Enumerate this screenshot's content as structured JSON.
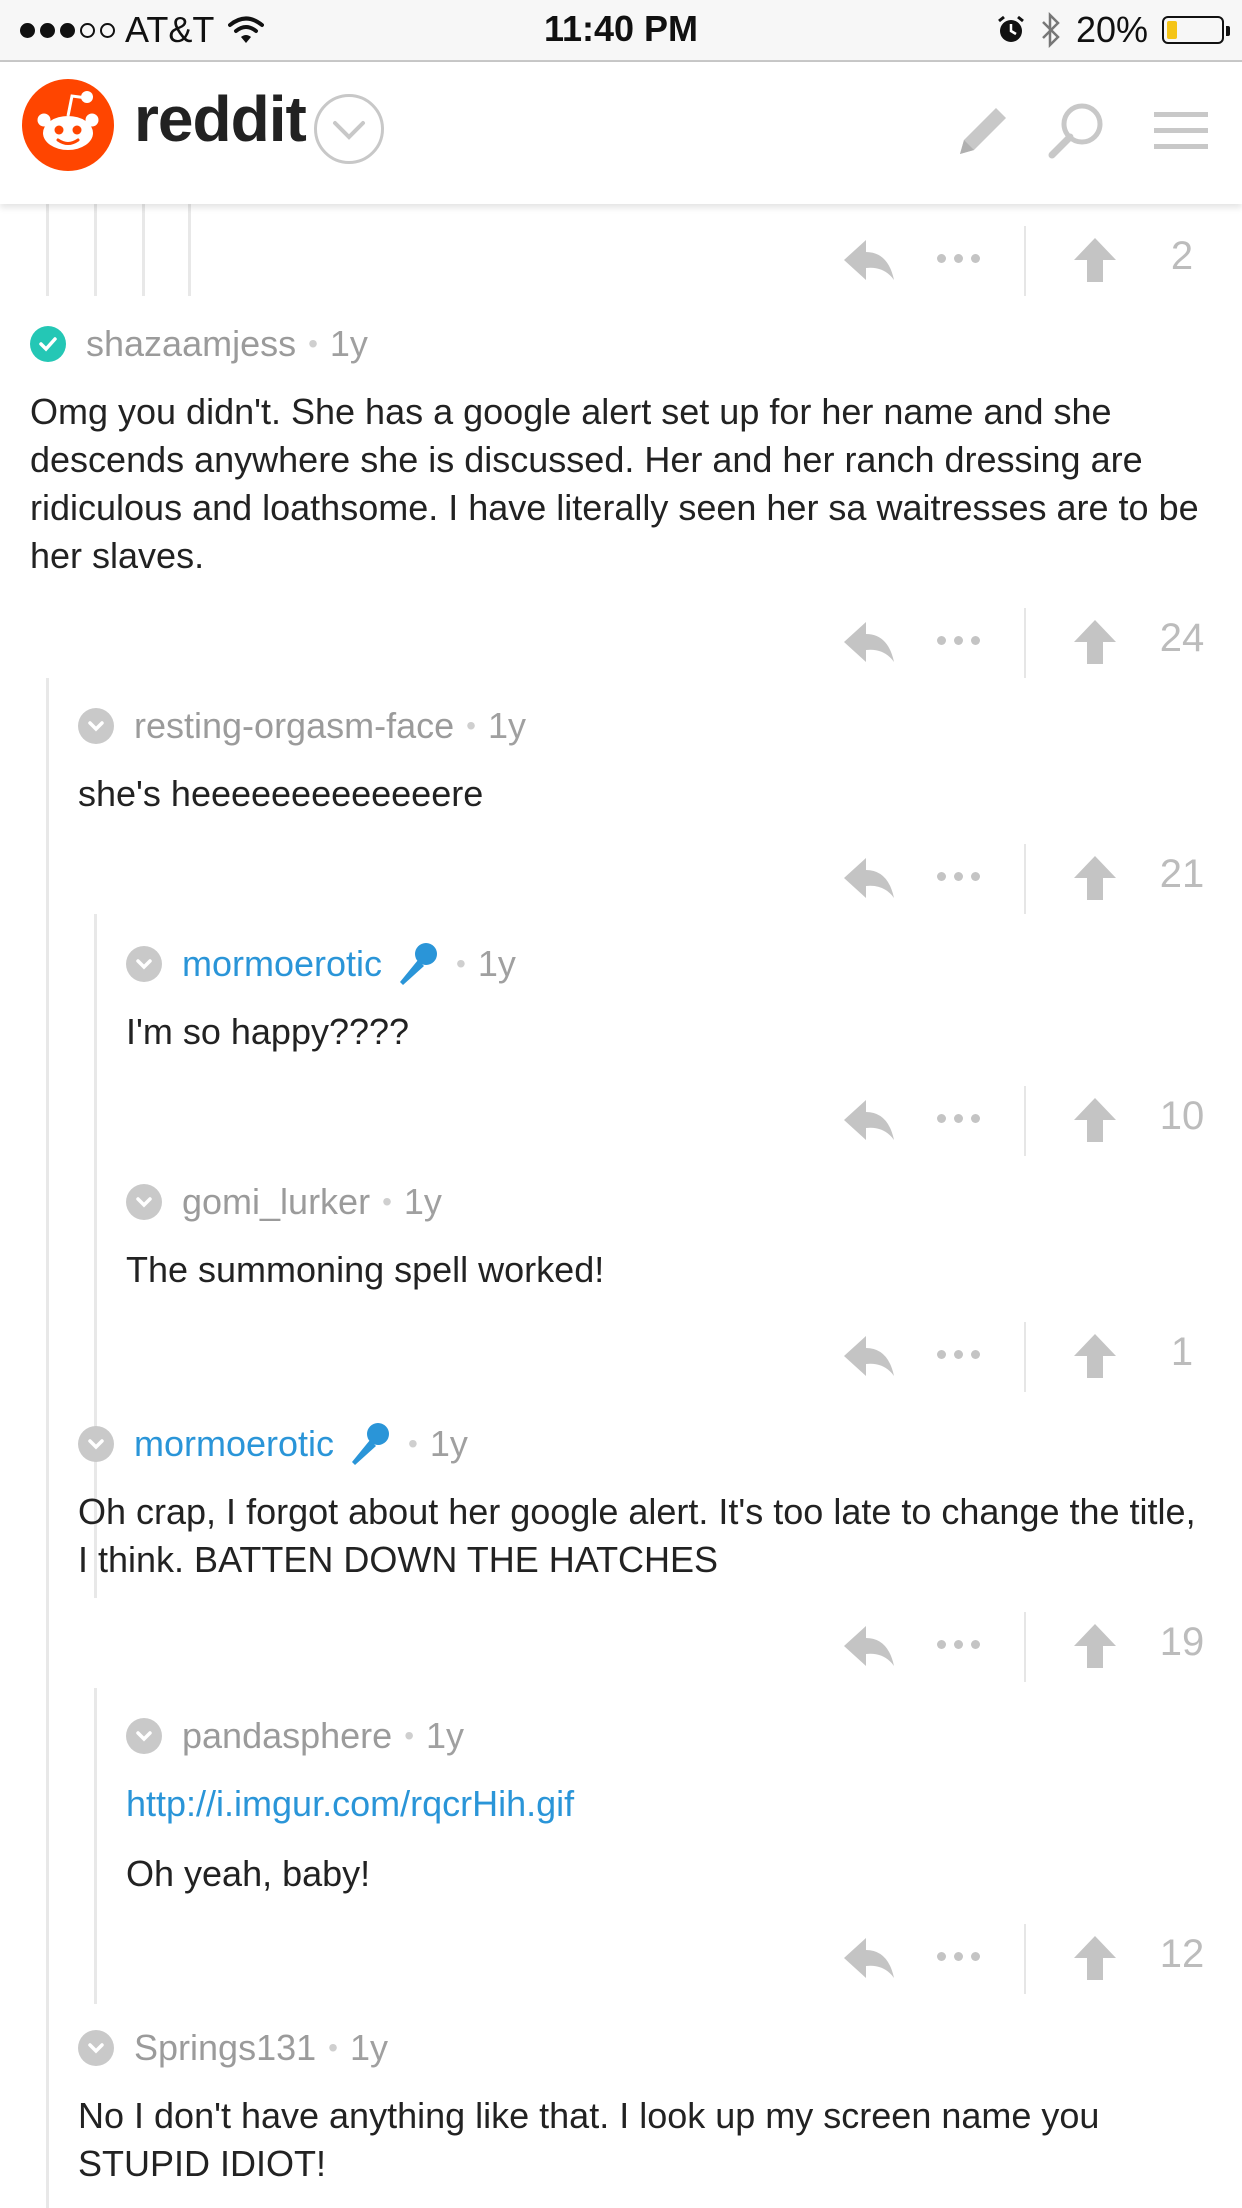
{
  "status_bar": {
    "carrier": "AT&T",
    "time": "11:40 PM",
    "battery": "20%",
    "battery_level": 0.2,
    "signal_bars_filled": 3,
    "signal_bars_total": 5
  },
  "header": {
    "brand": "reddit",
    "icons": [
      "reddit-logo-icon",
      "chevron-down-icon",
      "pencil-icon",
      "search-icon",
      "menu-icon"
    ]
  },
  "colors": {
    "brand_orange": "#ff4500",
    "link_blue": "#2a95d8",
    "op_teal": "#24c7b5",
    "muted_gray": "#a0a0a0"
  },
  "comments": [
    {
      "author": "",
      "age": "",
      "body": "",
      "score": "2"
    },
    {
      "author": "shazaamjess",
      "age": "1y",
      "body": "Omg you didn't. She has a google alert set up for her name and she descends anywhere she is discussed. Her and her ranch dressing are ridiculous and loathsome. I have literally seen her sa waitresses are to be her slaves.",
      "score": "24"
    },
    {
      "author": "resting-orgasm-face",
      "age": "1y",
      "body": "she's heeeeeeeeeeeeere",
      "score": "21"
    },
    {
      "author": "mormoerotic",
      "age": "1y",
      "body": "I'm so happy????",
      "score": "10"
    },
    {
      "author": "gomi_lurker",
      "age": "1y",
      "body": "The summoning spell worked!",
      "score": "1"
    },
    {
      "author": "mormoerotic",
      "age": "1y",
      "body": "Oh crap, I forgot about her google alert. It's too late to change the title, I think. BATTEN DOWN THE HATCHES",
      "score": "19"
    },
    {
      "author": "pandasphere",
      "age": "1y",
      "link": "http://i.imgur.com/rqcrHih.gif",
      "body": "Oh yeah, baby!",
      "score": "12"
    },
    {
      "author": "Springs131",
      "age": "1y",
      "body": "No I don't have anything like that. I look up my screen name you STUPID IDIOT!"
    }
  ]
}
